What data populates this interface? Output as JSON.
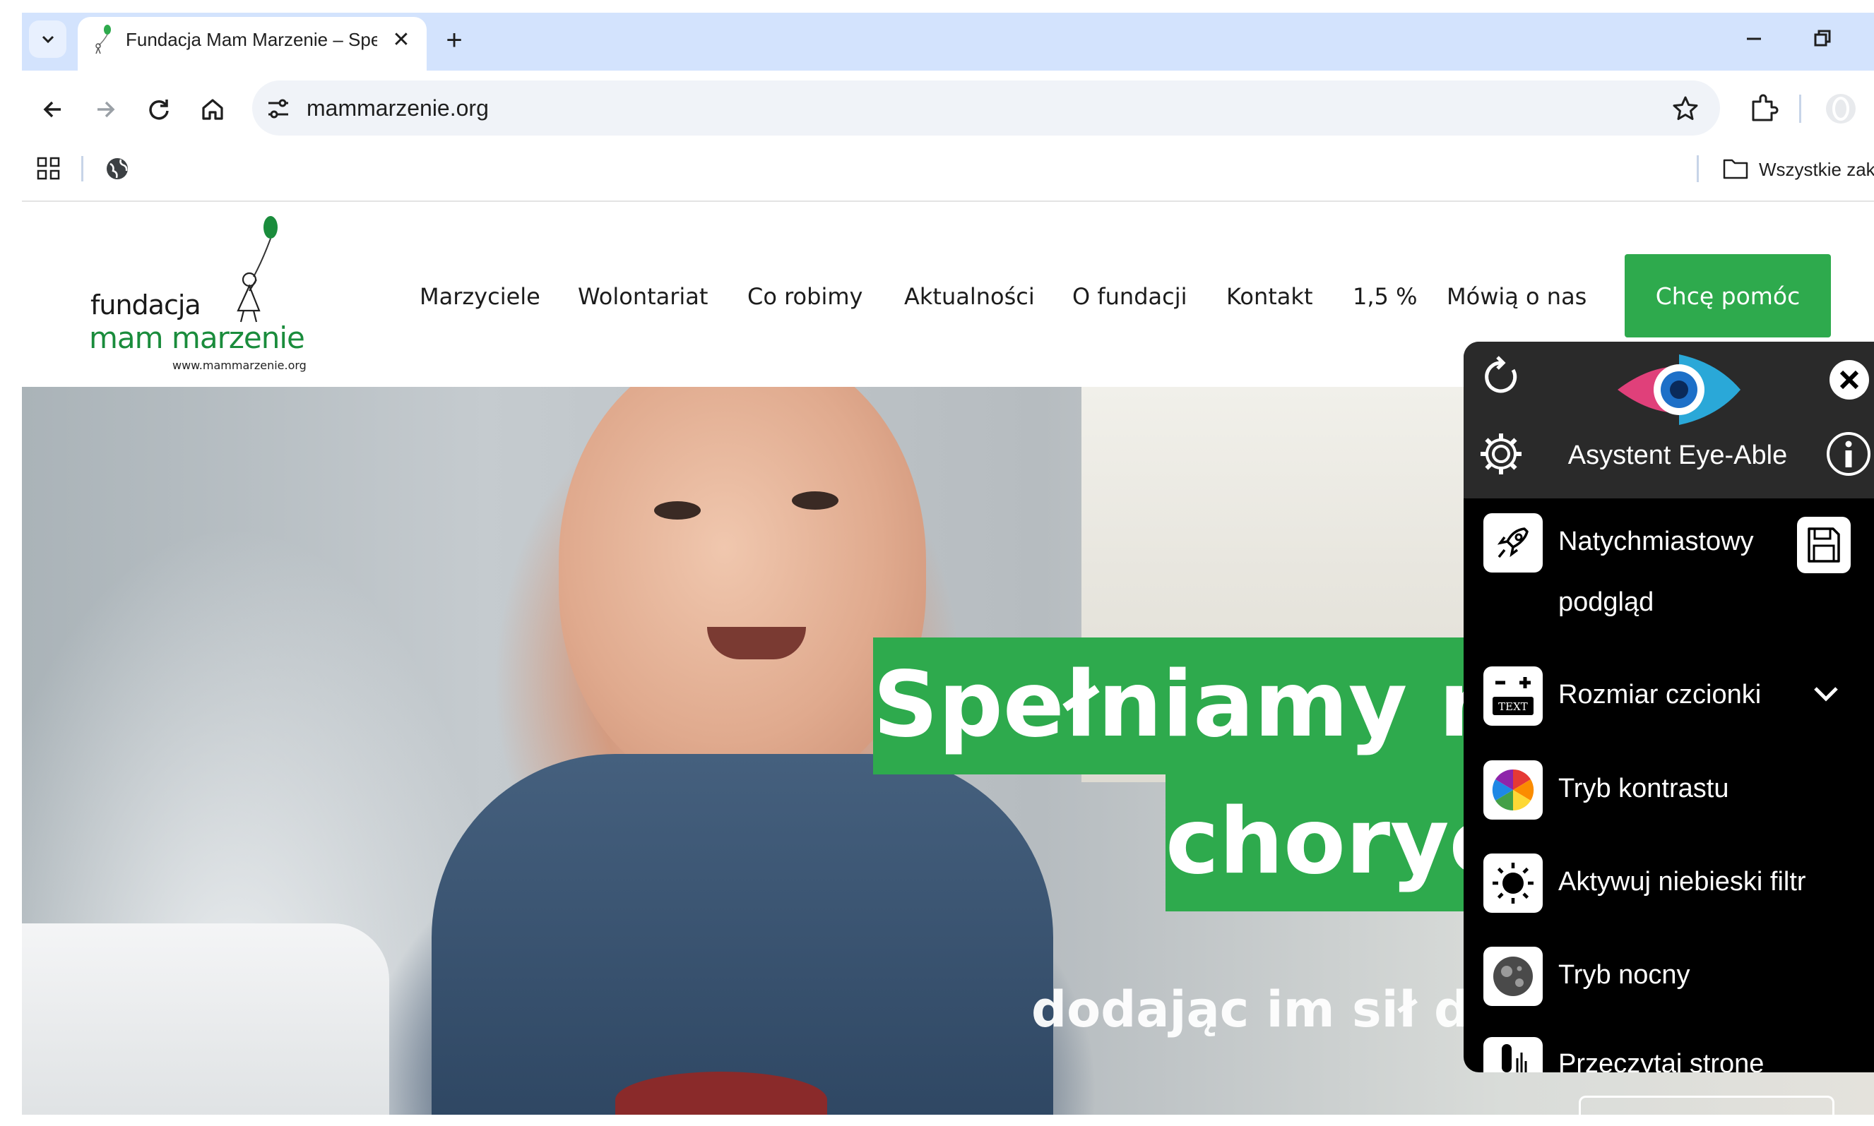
{
  "browser": {
    "tab": {
      "title": "Fundacja Mam Marzenie – Spełniamy marzenia",
      "close_glyph": "✕"
    },
    "new_tab_glyph": "+",
    "url": "mammarzenie.org",
    "bookmarks": {
      "all_label": "Wszystkie zakładki"
    }
  },
  "site": {
    "logo": {
      "line1": "fundacja",
      "line2": "mam marzenie",
      "url": "www.mammarzenie.org"
    },
    "nav": [
      "Marzyciele",
      "Wolontariat",
      "Co robimy",
      "Aktualności",
      "O fundacji",
      "Kontakt",
      "1,5 %",
      "Mówią o nas"
    ],
    "cta": "Chcę pomóc",
    "hero": {
      "line1": "Spełniamy m",
      "line2": "choryc",
      "subline": "dodając im sił do"
    },
    "brand_color": "#2eaa4d"
  },
  "eye_able": {
    "title": "Asystent Eye-Able",
    "items": [
      {
        "label_line1": "Natychmiastowy",
        "label_line2": "podgląd",
        "icon": "rocket-icon"
      },
      {
        "label": "Rozmiar czcionki",
        "icon": "text-size-icon",
        "icon_text": "TEXT"
      },
      {
        "label": "Tryb kontrastu",
        "icon": "color-wheel-icon"
      },
      {
        "label": "Aktywuj niebieski filtr",
        "icon": "sun-icon"
      },
      {
        "label": "Tryb nocny",
        "icon": "moon-icon"
      },
      {
        "label": "Przeczytaj stronę",
        "icon": "microphone-icon"
      }
    ]
  }
}
